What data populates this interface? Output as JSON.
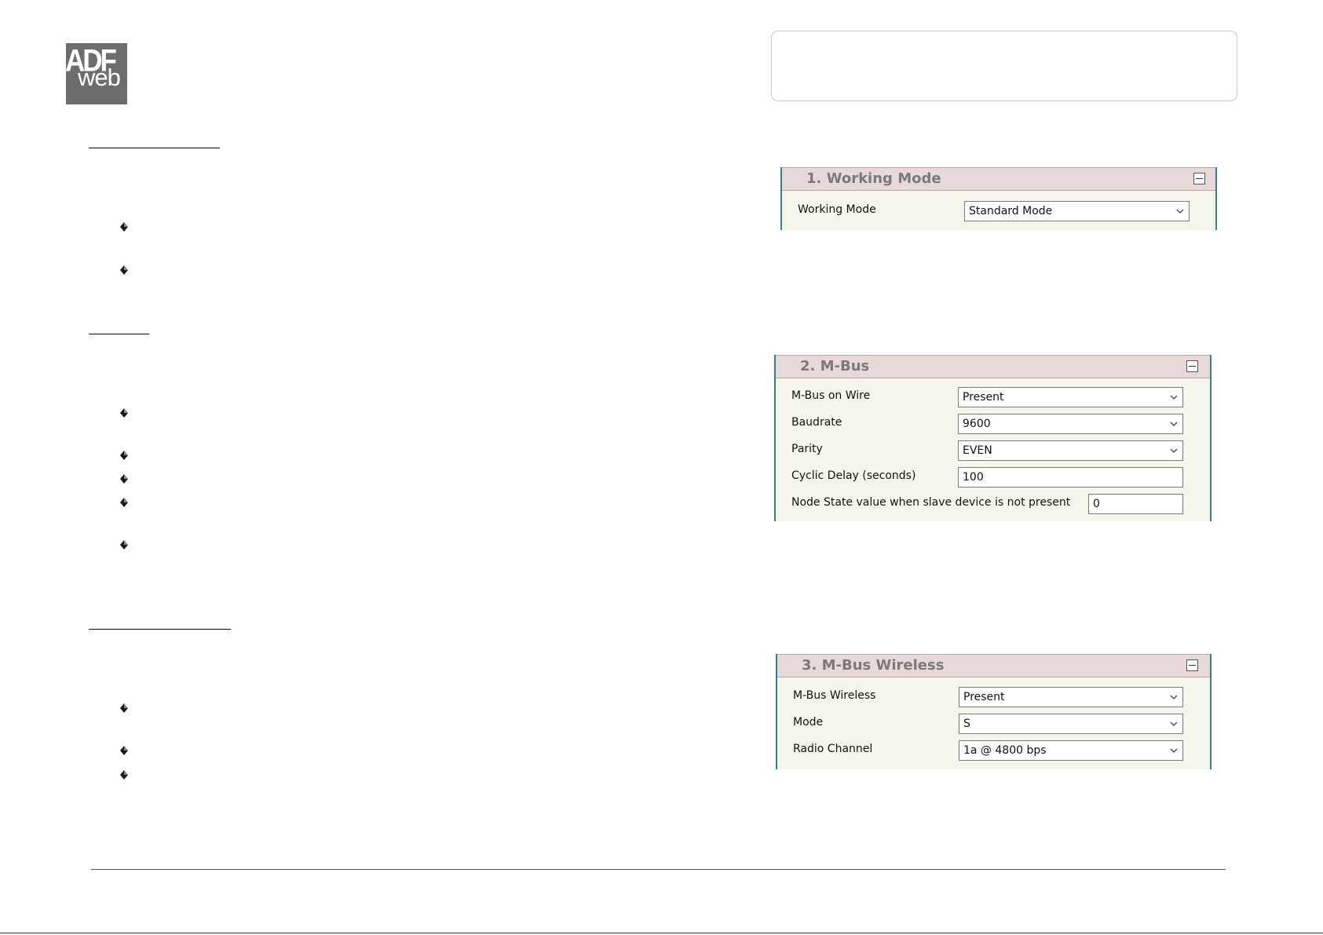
{
  "logo": {
    "line1": "ADF",
    "line2": "web"
  },
  "panels": [
    {
      "title": "1. Working Mode",
      "rows": [
        {
          "label": "Working Mode",
          "value": "Standard Mode",
          "kind": "select"
        }
      ]
    },
    {
      "title": "2. M-Bus",
      "rows": [
        {
          "label": "M-Bus on Wire",
          "value": "Present",
          "kind": "select"
        },
        {
          "label": "Baudrate",
          "value": "9600",
          "kind": "select"
        },
        {
          "label": "Parity",
          "value": "EVEN",
          "kind": "select"
        },
        {
          "label": "Cyclic Delay (seconds)",
          "value": "100",
          "kind": "text"
        },
        {
          "label": "Node State value when slave device is not present",
          "value": "0",
          "kind": "text"
        }
      ]
    },
    {
      "title": "3. M-Bus Wireless",
      "rows": [
        {
          "label": "M-Bus Wireless",
          "value": "Present",
          "kind": "select"
        },
        {
          "label": "Mode",
          "value": "S",
          "kind": "select"
        },
        {
          "label": "Radio Channel",
          "value": "1a @ 4800 bps",
          "kind": "select"
        }
      ]
    }
  ],
  "icons": {
    "bullet": "diamond-arrow-bullet-icon",
    "dropdown": "chevron-down-icon",
    "collapse": "collapse-minus-icon"
  },
  "colors": {
    "panel_border": "#3a7f86",
    "panel_header": "#e8d9d9",
    "panel_body": "#f6f5ec",
    "footer_line": "#2a5c8a",
    "logo_bg": "#6d6d6d"
  }
}
